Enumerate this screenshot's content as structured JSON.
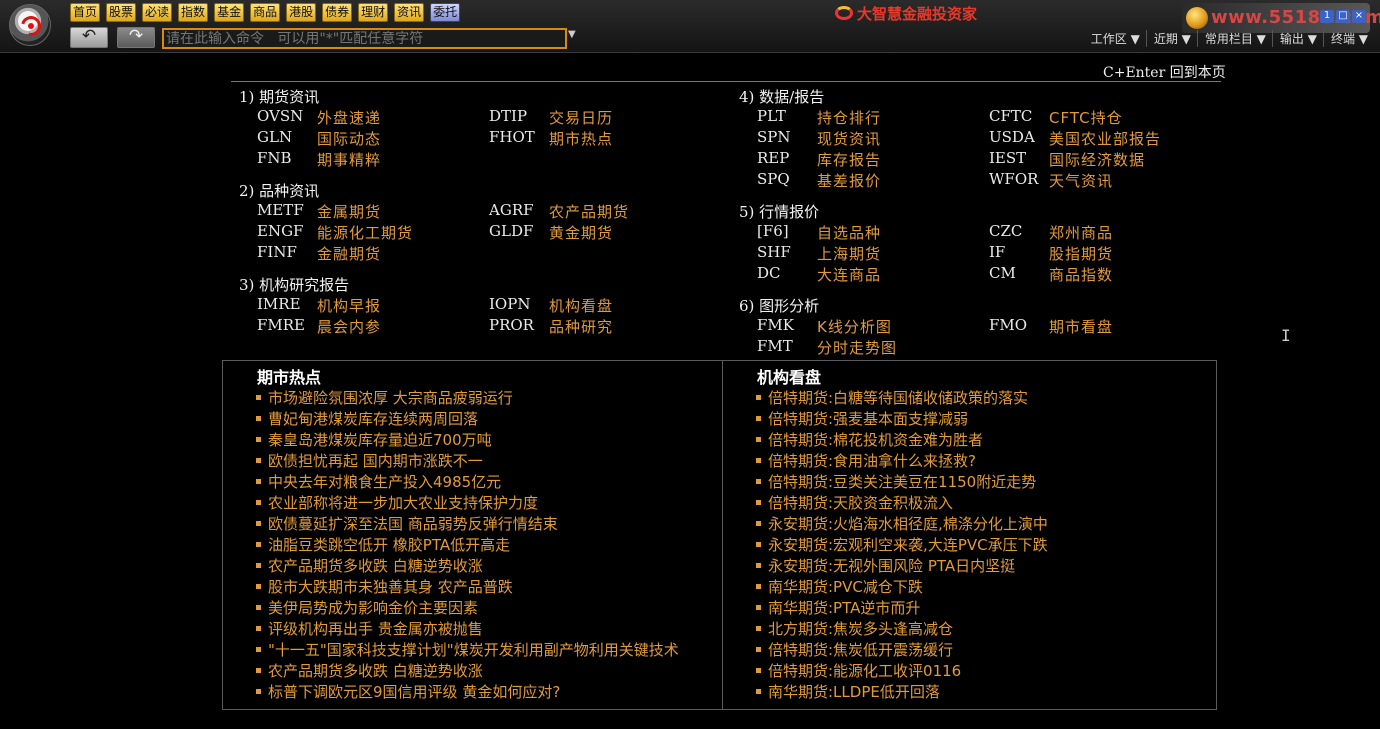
{
  "toolbar": {
    "nav": [
      "首页",
      "股票",
      "必读",
      "指数",
      "基金",
      "商品",
      "港股",
      "债券",
      "理财",
      "资讯",
      "委托"
    ],
    "back_symbol": "↶",
    "forward_symbol": "↷",
    "command_placeholder": "请在此输入命令   可以用\"*\"匹配任意字符",
    "dropdown_symbol": "▼",
    "brand": "大智慧金融投资家",
    "site_url": "www.55188.com",
    "window_controls": [
      "1",
      "□",
      "×"
    ],
    "menu": [
      "工作区 ▼",
      "近期 ▼",
      "常用栏目 ▼",
      "输出 ▼",
      "终端 ▼"
    ]
  },
  "content": {
    "home_hint": "C+Enter 回到本页",
    "sections": [
      {
        "title": "1) 期货资讯",
        "items": [
          {
            "code": "OVSN",
            "label": "外盘速递"
          },
          {
            "code": "DTIP",
            "label": "交易日历"
          },
          {
            "code": "GLN",
            "label": "国际动态"
          },
          {
            "code": "FHOT",
            "label": "期市热点"
          },
          {
            "code": "FNB",
            "label": "期事精粹"
          }
        ]
      },
      {
        "title": "2) 品种资讯",
        "items": [
          {
            "code": "METF",
            "label": "金属期货"
          },
          {
            "code": "AGRF",
            "label": "农产品期货"
          },
          {
            "code": "ENGF",
            "label": "能源化工期货"
          },
          {
            "code": "GLDF",
            "label": "黄金期货"
          },
          {
            "code": "FINF",
            "label": "金融期货"
          }
        ]
      },
      {
        "title": "3) 机构研究报告",
        "items": [
          {
            "code": "IMRE",
            "label": "机构早报"
          },
          {
            "code": "IOPN",
            "label": "机构看盘"
          },
          {
            "code": "FMRE",
            "label": "晨会内参"
          },
          {
            "code": "PROR",
            "label": "品种研究"
          }
        ]
      },
      {
        "title": "4) 数据/报告",
        "items": [
          {
            "code": "PLT",
            "label": "持仓排行"
          },
          {
            "code": "CFTC",
            "label": "CFTC持仓"
          },
          {
            "code": "SPN",
            "label": "现货资讯"
          },
          {
            "code": "USDA",
            "label": "美国农业部报告"
          },
          {
            "code": "REP",
            "label": "库存报告"
          },
          {
            "code": "IEST",
            "label": "国际经济数据"
          },
          {
            "code": "SPQ",
            "label": "基差报价"
          },
          {
            "code": "WFOR",
            "label": "天气资讯"
          }
        ]
      },
      {
        "title": "5) 行情报价",
        "items": [
          {
            "code": "[F6]",
            "label": "自选品种"
          },
          {
            "code": "CZC",
            "label": "郑州商品"
          },
          {
            "code": "SHF",
            "label": "上海期货"
          },
          {
            "code": "IF",
            "label": "股指期货"
          },
          {
            "code": "DC",
            "label": "大连商品"
          },
          {
            "code": "CM",
            "label": "商品指数"
          }
        ]
      },
      {
        "title": "6) 图形分析",
        "items": [
          {
            "code": "FMK",
            "label": "K线分析图"
          },
          {
            "code": "FMO",
            "label": "期市看盘"
          },
          {
            "code": "FMT",
            "label": "分时走势图"
          }
        ]
      }
    ],
    "left_panel": {
      "title": "期市热点",
      "items": [
        "市场避险氛围浓厚  大宗商品疲弱运行",
        "曹妃甸港煤炭库存连续两周回落",
        "秦皇岛港煤炭库存量迫近700万吨",
        "欧债担忧再起  国内期市涨跌不一",
        "中央去年对粮食生产投入4985亿元",
        "农业部称将进一步加大农业支持保护力度",
        "欧债蔓延扩深至法国  商品弱势反弹行情结束",
        "油脂豆类跳空低开  橡胶PTA低开高走",
        "农产品期货多收跌  白糖逆势收涨",
        "股市大跌期市未独善其身  农产品普跌",
        "美伊局势成为影响金价主要因素",
        "评级机构再出手  贵金属亦被抛售",
        "\"十一五\"国家科技支撑计划\"煤炭开发利用副产物利用关键技术",
        "农产品期货多收跌  白糖逆势收涨",
        "标普下调欧元区9国信用评级  黄金如何应对?"
      ]
    },
    "right_panel": {
      "title": "机构看盘",
      "items": [
        "倍特期货:白糖等待国储收储政策的落实",
        "倍特期货:强麦基本面支撑减弱",
        "倍特期货:棉花投机资金难为胜者",
        "倍特期货:食用油拿什么来拯救?",
        "倍特期货:豆类关注美豆在1150附近走势",
        "倍特期货:天胶资金积极流入",
        "永安期货:火焰海水相径庭,棉涤分化上演中",
        "永安期货:宏观利空来袭,大连PVC承压下跌",
        "永安期货:无视外围风险  PTA日内坚挺",
        "南华期货:PVC减仓下跌",
        "南华期货:PTA逆市而升",
        "北方期货:焦炭多头逢高减仓",
        "倍特期货:焦炭低开震荡缓行",
        "倍特期货:能源化工收评0116",
        "南华期货:LLDPE低开回落"
      ]
    },
    "cursor_glyph": "I"
  },
  "colors": {
    "accent": "#e39a3a",
    "background": "#000000",
    "brand": "#e8382a"
  }
}
